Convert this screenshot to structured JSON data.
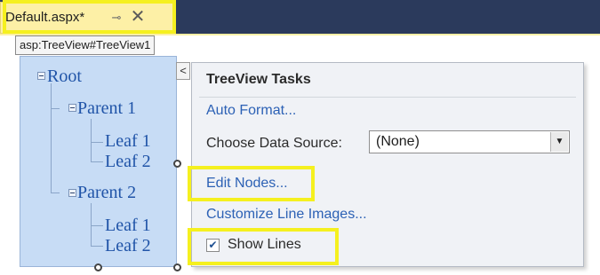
{
  "tab": {
    "title": "Default.aspx*",
    "pin_glyph": "⊸",
    "close_glyph": "✕"
  },
  "control_tag": "asp:TreeView#TreeView1",
  "tree": {
    "root": "Root",
    "parent1": "Parent 1",
    "leaf1a": "Leaf 1",
    "leaf1b": "Leaf 2",
    "parent2": "Parent 2",
    "leaf2a": "Leaf 1",
    "leaf2b": "Leaf 2"
  },
  "smart_tag_glyph": "<",
  "tasks": {
    "title": "TreeView Tasks",
    "auto_format": "Auto Format...",
    "choose_data_source_label": "Choose Data Source:",
    "data_source_value": "(None)",
    "edit_nodes": "Edit Nodes...",
    "customize_line_images": "Customize Line Images...",
    "show_lines": "Show Lines",
    "show_lines_checked": true
  },
  "colors": {
    "title_bar": "#2b3a5c",
    "active_tab": "#fdf0a6",
    "tree_selection": "#c7dcf5",
    "tree_text": "#2054a8",
    "link": "#2c61b5",
    "highlight": "#f5f01f"
  },
  "icons": {
    "pin": "pin-icon",
    "close": "close-icon",
    "dropdown": "chevron-down-icon",
    "check": "checkmark-icon"
  }
}
